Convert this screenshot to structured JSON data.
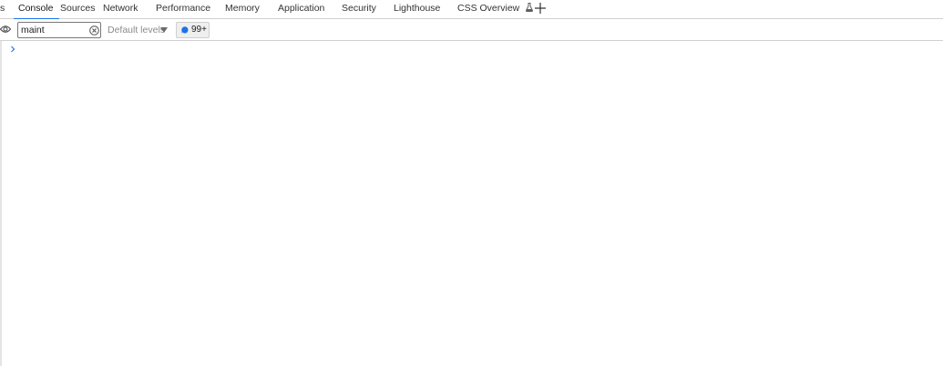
{
  "tabs": [
    {
      "label": "s",
      "active": false
    },
    {
      "label": "Console",
      "active": true
    },
    {
      "label": "Sources",
      "active": false
    },
    {
      "label": "Network",
      "active": false
    },
    {
      "label": "Performance",
      "active": false
    },
    {
      "label": "Memory",
      "active": false
    },
    {
      "label": "Application",
      "active": false
    },
    {
      "label": "Security",
      "active": false
    },
    {
      "label": "Lighthouse",
      "active": false
    },
    {
      "label": "CSS Overview",
      "active": false,
      "icon": "flask-icon"
    }
  ],
  "add_tab_icon": "plus-icon",
  "toolbar": {
    "live_expression_icon": "eye-icon",
    "filter_value": "maint",
    "clear_icon": "clear-circle-icon",
    "levels_label": "Default levels",
    "levels_icon": "triangle-down-icon",
    "issues_icon": "message-bubble-icon",
    "issues_count": "99+"
  },
  "console": {
    "prompt_icon": "chevron-right-icon"
  },
  "colors": {
    "accent": "#1a73e8",
    "border": "#d0d0d0",
    "muted_text": "#8a8a8a"
  }
}
